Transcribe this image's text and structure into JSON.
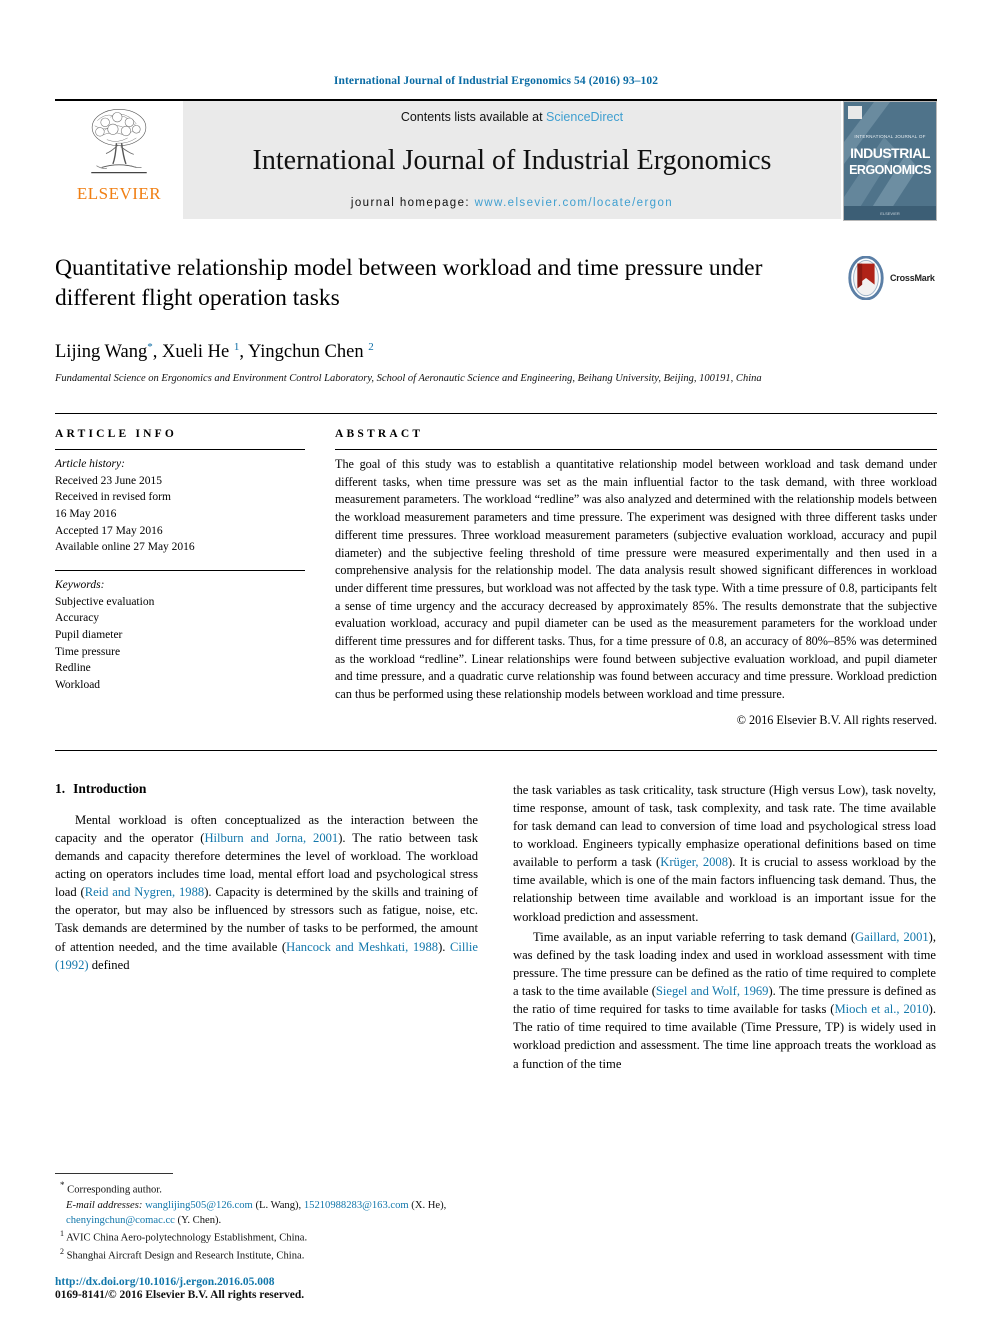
{
  "running_head": "International Journal of Industrial Ergonomics 54 (2016) 93–102",
  "masthead": {
    "publisher": "ELSEVIER",
    "contents_prefix": "Contents lists available at ",
    "contents_link": "ScienceDirect",
    "journal_title": "International Journal of Industrial Ergonomics",
    "homepage_prefix": "journal homepage: ",
    "homepage_url": "www.elsevier.com/locate/ergon",
    "cover_line1": "INDUSTRIAL",
    "cover_line2": "ERGONOMICS",
    "cover_kicker": "INTERNATIONAL JOURNAL OF"
  },
  "article": {
    "title": "Quantitative relationship model between workload and time pressure under different flight operation tasks",
    "crossmark_label": "CrossMark",
    "authors_html": "Lijing Wang<sup class=\"star\">*</sup>, Xueli He <sup>1</sup>, Yingchun Chen <sup>2</sup>",
    "affiliation": "Fundamental Science on Ergonomics and Environment Control Laboratory, School of Aeronautic Science and Engineering, Beihang University, Beijing, 100191, China"
  },
  "article_info": {
    "heading": "ARTICLE INFO",
    "history_label": "Article history:",
    "history": [
      "Received 23 June 2015",
      "Received in revised form",
      "16 May 2016",
      "Accepted 17 May 2016",
      "Available online 27 May 2016"
    ],
    "keywords_label": "Keywords:",
    "keywords": [
      "Subjective evaluation",
      "Accuracy",
      "Pupil diameter",
      "Time pressure",
      "Redline",
      "Workload"
    ]
  },
  "abstract": {
    "heading": "ABSTRACT",
    "text": "The goal of this study was to establish a quantitative relationship model between workload and task demand under different tasks, when time pressure was set as the main influential factor to the task demand, with three workload measurement parameters. The workload “redline” was also analyzed and determined with the relationship models between the workload measurement parameters and time pressure. The experiment was designed with three different tasks under different time pressures. Three workload measurement parameters (subjective evaluation workload, accuracy and pupil diameter) and the subjective feeling threshold of time pressure were measured experimentally and then used in a comprehensive analysis for the relationship model. The data analysis result showed significant differences in workload under different time pressures, but workload was not affected by the task type. With a time pressure of 0.8, participants felt a sense of time urgency and the accuracy decreased by approximately 85%. The results demonstrate that the subjective evaluation workload, accuracy and pupil diameter can be used as the measurement parameters for the workload under different time pressures and for different tasks. Thus, for a time pressure of 0.8, an accuracy of 80%–85% was determined as the workload “redline”. Linear relationships were found between subjective evaluation workload, and pupil diameter and time pressure, and a quadratic curve relationship was found between accuracy and time pressure. Workload prediction can thus be performed using these relationship models between workload and time pressure.",
    "copyright": "© 2016 Elsevier B.V. All rights reserved."
  },
  "introduction": {
    "number": "1.",
    "title": "Introduction",
    "left_paragraph_html": "Mental workload is often conceptualized as the interaction between the capacity and the operator (<span class=\"ref\">Hilburn and Jorna, 2001</span>). The ratio between task demands and capacity therefore determines the level of workload. The workload acting on operators includes time load, mental effort load and psychological stress load (<span class=\"ref\">Reid and Nygren, 1988</span>). Capacity is determined by the skills and training of the operator, but may also be influenced by stressors such as fatigue, noise, etc. Task demands are determined by the number of tasks to be performed, the amount of attention needed, and the time available (<span class=\"ref\">Hancock and Meshkati, 1988</span>). <span class=\"ref\">Cillie (1992)</span> defined",
    "right_paragraph1_html": "the task variables as task criticality, task structure (High versus Low), task novelty, time response, amount of task, task complexity, and task rate. The time available for task demand can lead to conversion of time load and psychological stress load to workload. Engineers typically emphasize operational definitions based on time available to perform a task (<span class=\"ref\">Krüger, 2008</span>). It is crucial to assess workload by the time available, which is one of the main factors influencing task demand. Thus, the relationship between time available and workload is an important issue for the workload prediction and assessment.",
    "right_paragraph2_html": "Time available, as an input variable referring to task demand (<span class=\"ref\">Gaillard, 2001</span>), was defined by the task loading index and used in workload assessment with time pressure. The time pressure can be defined as the ratio of time required to complete a task to the time available (<span class=\"ref\">Siegel and Wolf, 1969</span>). The time pressure is defined as the ratio of time required for tasks to time available for tasks (<span class=\"ref\">Mioch et al., 2010</span>). The ratio of time required to time available (Time Pressure, TP) is widely used in workload prediction and assessment. The time line approach treats the workload as a function of the time"
  },
  "footnotes": {
    "corresponding": "Corresponding author.",
    "email_label": "E-mail addresses:",
    "emails_html": "<span class=\"email\">wanglijing505@126.com</span> (L. Wang), <span class=\"email\">15210988283@163.com</span> (X. He), <span class=\"email\">chenyingchun@comac.cc</span> (Y. Chen).",
    "note1": "AVIC China Aero-polytechnology Establishment, China.",
    "note2": "Shanghai Aircraft Design and Research Institute, China.",
    "doi": "http://dx.doi.org/10.1016/j.ergon.2016.05.008",
    "issn": "0169-8141/© 2016 Elsevier B.V. All rights reserved."
  },
  "colors": {
    "link_blue": "#1277ab",
    "header_blue": "#0a6ba4",
    "sciencedirect_blue": "#3f9fd0",
    "elsevier_orange": "#f07f13",
    "banner_gray": "#eaeaea"
  }
}
